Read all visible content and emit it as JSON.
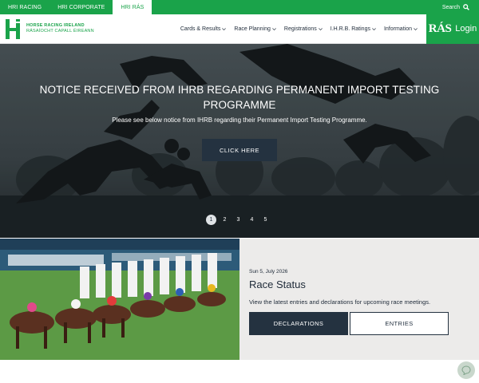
{
  "topbar": {
    "links": [
      {
        "label": "HRI RACING"
      },
      {
        "label": "HRI CORPORATE"
      },
      {
        "label": "HRI RÁS"
      }
    ],
    "search_label": "Search"
  },
  "brand": {
    "line1": "HORSE RACING IRELAND",
    "line2": "RÁSAÍOCHT CAPALL ÉIREANN"
  },
  "nav": {
    "items": [
      {
        "label": "Cards & Results"
      },
      {
        "label": "Race Planning"
      },
      {
        "label": "Registrations"
      },
      {
        "label": "I.H.R.B. Ratings"
      },
      {
        "label": "Information"
      }
    ],
    "ras_logo": "RÁS",
    "login_label": "Login"
  },
  "hero": {
    "title": "NOTICE RECEIVED FROM IHRB REGARDING PERMANENT IMPORT TESTING PROGRAMME",
    "subtitle": "Please see below notice from IHRB regarding their Permanent Import Testing Programme.",
    "button_label": "CLICK HERE",
    "pages": [
      "1",
      "2",
      "3",
      "4",
      "5"
    ],
    "active_page": 1
  },
  "race_status": {
    "date": "Sun 5, July 2026",
    "title": "Race Status",
    "description": "View the latest entries and declarations for upcoming race meetings.",
    "declarations_label": "DECLARATIONS",
    "entries_label": "ENTRIES"
  },
  "colors": {
    "brand_green": "#1aa34a",
    "navy": "#243240",
    "panel_grey": "#ecebea"
  },
  "icons": [
    "search-icon",
    "chevron-down-icon",
    "chat-icon"
  ]
}
